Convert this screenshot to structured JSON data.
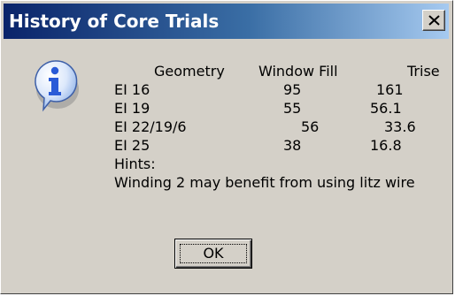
{
  "window": {
    "title": "History of Core Trials",
    "close_label": "close"
  },
  "table": {
    "headers": [
      "Geometry",
      "Window Fill",
      "Trise"
    ],
    "rows": [
      [
        "EI 16",
        "95",
        "161"
      ],
      [
        "EI 19",
        "55",
        "56.1"
      ],
      [
        "EI 22/19/6",
        "56",
        "33.6"
      ],
      [
        "EI 25",
        "38",
        "16.8"
      ]
    ]
  },
  "hints": {
    "label": "Hints:",
    "text": "Winding 2 may benefit from using litz wire"
  },
  "buttons": {
    "ok_label": "OK"
  },
  "icons": {
    "dialog_icon": "info-icon",
    "close_icon": "close-icon"
  },
  "colors": {
    "titlebar_start": "#0a246a",
    "titlebar_end": "#a6caf0",
    "dialog_bg": "#d4d0c8",
    "info_blue": "#2a5bd7"
  }
}
